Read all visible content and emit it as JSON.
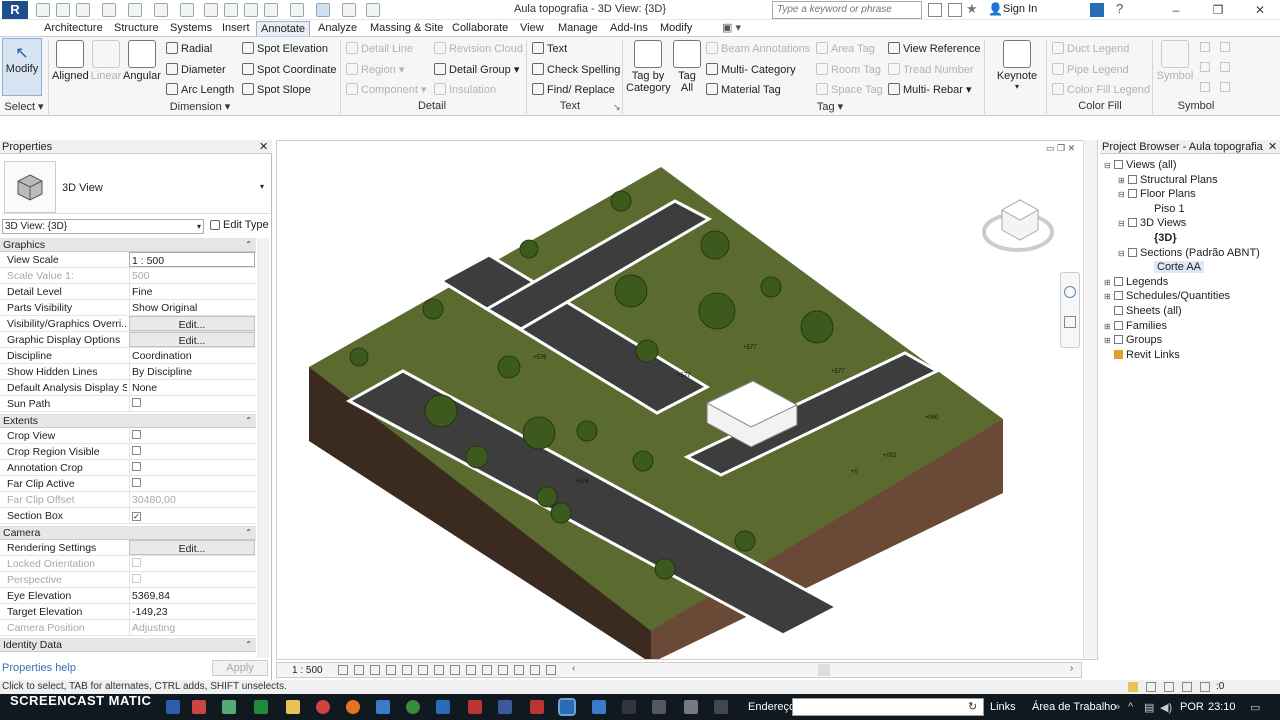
{
  "app": {
    "logo": "R",
    "doc_title": "Aula topografia - 3D View: {3D}",
    "search_placeholder": "Type a keyword or phrase",
    "sign_in": "Sign In"
  },
  "tabs": [
    "Architecture",
    "Structure",
    "Systems",
    "Insert",
    "Annotate",
    "Analyze",
    "Massing & Site",
    "Collaborate",
    "View",
    "Manage",
    "Add-Ins",
    "Modify"
  ],
  "active_tab": "Annotate",
  "ribbon": {
    "modify": "Modify",
    "select_panel": "Select",
    "dimension": {
      "title": "Dimension",
      "aligned": "Aligned",
      "linear": "Linear",
      "angular": "Angular",
      "radial": "Radial",
      "diameter": "Diameter",
      "arc_length": "Arc  Length",
      "spot_elevation": "Spot  Elevation",
      "spot_coordinate": "Spot  Coordinate",
      "spot_slope": "Spot  Slope"
    },
    "detail": {
      "title": "Detail",
      "detail_line": "Detail  Line",
      "region": "Region",
      "component": "Component",
      "revision_cloud": "Revision  Cloud",
      "detail_group": "Detail  Group",
      "insulation": "Insulation"
    },
    "text": {
      "title": "Text",
      "text": "Text",
      "check_spelling": "Check  Spelling",
      "find_replace": "Find/  Replace"
    },
    "tag": {
      "title": "Tag",
      "tag_by_category": "Tag by Category",
      "tag_all": "Tag All",
      "beam_annotations": "Beam  Annotations",
      "multi_category": "Multi-  Category",
      "material_tag": "Material  Tag",
      "area_tag": "Area  Tag",
      "room_tag": "Room  Tag",
      "space_tag": "Space  Tag",
      "view_reference": "View  Reference",
      "tread_number": "Tread  Number",
      "multi_rebar": "Multi-  Rebar",
      "keynote": "Keynote"
    },
    "color_fill": {
      "title": "Color Fill",
      "duct_legend": "Duct  Legend",
      "pipe_legend": "Pipe  Legend",
      "color_fill_legend": "Color Fill  Legend"
    },
    "symbol": {
      "title": "Symbol",
      "symbol": "Symbol"
    }
  },
  "properties": {
    "title": "Properties",
    "type_name": "3D View",
    "instance": "3D View: {3D}",
    "edit_type": "Edit Type",
    "groups": {
      "graphics": "Graphics",
      "extents": "Extents",
      "camera": "Camera",
      "identity": "Identity Data"
    },
    "graphics": [
      {
        "k": "View Scale",
        "v": "1 : 500",
        "style": "box"
      },
      {
        "k": "Scale Value    1:",
        "v": "500",
        "style": "dis"
      },
      {
        "k": "Detail Level",
        "v": "Fine"
      },
      {
        "k": "Parts Visibility",
        "v": "Show Original"
      },
      {
        "k": "Visibility/Graphics Overri...",
        "v": "Edit...",
        "style": "btn"
      },
      {
        "k": "Graphic Display Options",
        "v": "Edit...",
        "style": "btn"
      },
      {
        "k": "Discipline",
        "v": "Coordination"
      },
      {
        "k": "Show Hidden Lines",
        "v": "By Discipline"
      },
      {
        "k": "Default Analysis Display S...",
        "v": "None"
      },
      {
        "k": "Sun Path",
        "v": "",
        "style": "check"
      }
    ],
    "extents": [
      {
        "k": "Crop View",
        "v": "",
        "style": "check"
      },
      {
        "k": "Crop Region Visible",
        "v": "",
        "style": "check"
      },
      {
        "k": "Annotation Crop",
        "v": "",
        "style": "check"
      },
      {
        "k": "Far Clip Active",
        "v": "",
        "style": "check"
      },
      {
        "k": "Far Clip Offset",
        "v": "30480,00",
        "style": "dis"
      },
      {
        "k": "Section Box",
        "v": "✓",
        "style": "check"
      }
    ],
    "camera": [
      {
        "k": "Rendering Settings",
        "v": "Edit...",
        "style": "btn"
      },
      {
        "k": "Locked Orientation",
        "v": "",
        "style": "dischk"
      },
      {
        "k": "Perspective",
        "v": "",
        "style": "dischk"
      },
      {
        "k": "Eye Elevation",
        "v": "5369,84"
      },
      {
        "k": "Target Elevation",
        "v": "-149,23"
      },
      {
        "k": "Camera Position",
        "v": "Adjusting",
        "style": "dis"
      }
    ],
    "help": "Properties help",
    "apply": "Apply"
  },
  "viewport": {
    "scale": "1 : 500",
    "contour_labels": [
      "+577",
      "+577",
      "+577",
      "+000",
      "+0",
      "+002",
      "+074",
      "+576"
    ]
  },
  "browser": {
    "title": "Project Browser - Aula topografia",
    "items": [
      {
        "label": "Views (all)",
        "lvl": 0,
        "tw": "⊟"
      },
      {
        "label": "Structural Plans",
        "lvl": 1,
        "tw": "⊞"
      },
      {
        "label": "Floor Plans",
        "lvl": 1,
        "tw": "⊟"
      },
      {
        "label": "Piso 1",
        "lvl": 2,
        "tw": ""
      },
      {
        "label": "3D Views",
        "lvl": 1,
        "tw": "⊟"
      },
      {
        "label": "{3D}",
        "lvl": 2,
        "tw": "",
        "bold": true
      },
      {
        "label": "Sections (Padrão ABNT)",
        "lvl": 1,
        "tw": "⊟"
      },
      {
        "label": "Corte AA",
        "lvl": 2,
        "tw": "",
        "sel": true
      },
      {
        "label": "Legends",
        "lvl": 0,
        "tw": "⊞"
      },
      {
        "label": "Schedules/Quantities",
        "lvl": 0,
        "tw": "⊞"
      },
      {
        "label": "Sheets (all)",
        "lvl": 0,
        "tw": ""
      },
      {
        "label": "Families",
        "lvl": 0,
        "tw": "⊞"
      },
      {
        "label": "Groups",
        "lvl": 0,
        "tw": "⊞"
      },
      {
        "label": "Revit Links",
        "lvl": 0,
        "tw": ""
      }
    ]
  },
  "status": "Click to select, TAB for alternates, CTRL adds, SHIFT unselects.",
  "status_right": ":0",
  "taskbar": {
    "watermark": "SCREENCAST  MATIC",
    "address_label": "Endereço",
    "links": "Links",
    "desktop": "Área de Trabalho",
    "lang": "POR",
    "time": "23:10"
  }
}
